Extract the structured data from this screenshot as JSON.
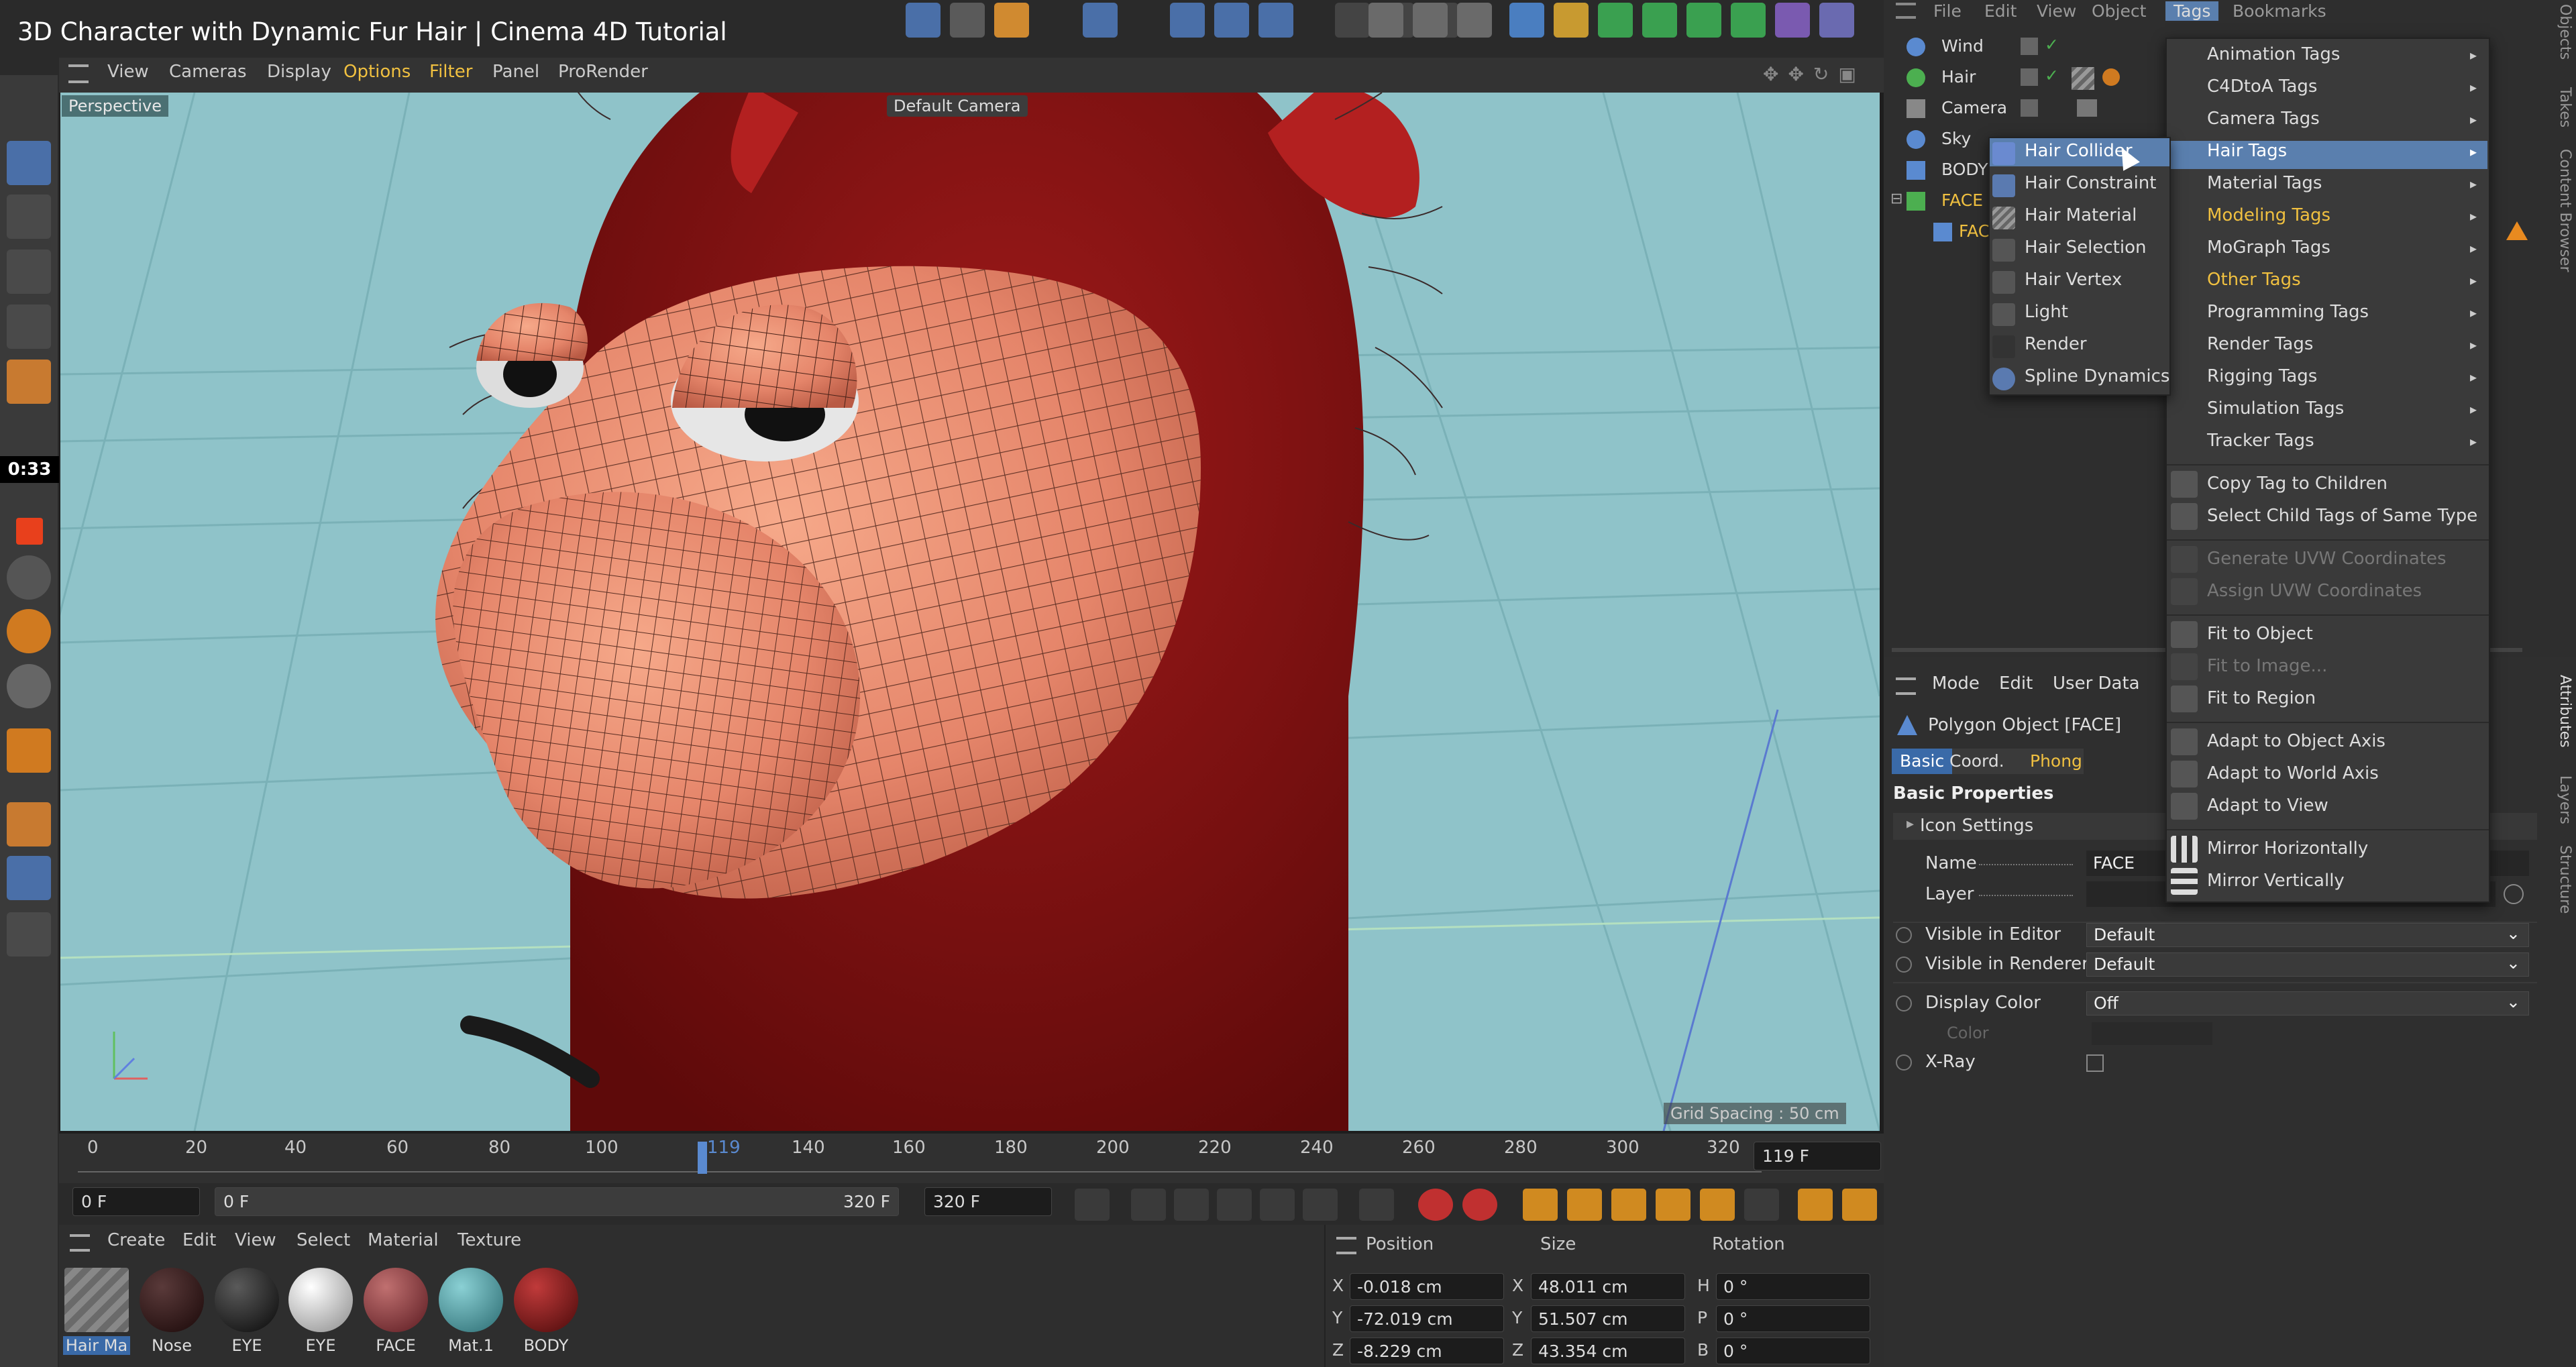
{
  "video": {
    "title": "3D Character with Dynamic Fur Hair | Cinema 4D Tutorial",
    "timestamp": "0:33"
  },
  "viewport": {
    "menu": [
      "View",
      "Cameras",
      "Display",
      "Options",
      "Filter",
      "Panel",
      "ProRender"
    ],
    "view_name": "Perspective",
    "camera": "Default Camera",
    "grid_spacing": "Grid Spacing : 50 cm"
  },
  "timeline": {
    "ticks": [
      "0",
      "20",
      "40",
      "60",
      "80",
      "100",
      "119",
      "140",
      "160",
      "180",
      "200",
      "220",
      "240",
      "260",
      "280",
      "300",
      "320"
    ],
    "current_frame": "119 F",
    "start": "0 F",
    "range_start": "0 F",
    "range_end": "320 F",
    "end": "320 F"
  },
  "material_manager": {
    "menu": [
      "Create",
      "Edit",
      "View",
      "Select",
      "Material",
      "Texture"
    ],
    "materials": [
      {
        "name": "Hair Ma",
        "color": "#7a7a7a"
      },
      {
        "name": "Nose",
        "color": "#2a1414"
      },
      {
        "name": "EYE",
        "color": "#141414"
      },
      {
        "name": "EYE",
        "color": "#cfcfcf"
      },
      {
        "name": "FACE",
        "color": "#8a3a3e"
      },
      {
        "name": "Mat.1",
        "color": "#4a9ea4"
      },
      {
        "name": "BODY",
        "color": "#7a1414"
      }
    ]
  },
  "coordinates": {
    "headers": [
      "Position",
      "Size",
      "Rotation"
    ],
    "rows": [
      {
        "axis": "X",
        "pos": "-0.018 cm",
        "saxis": "X",
        "size": "48.011 cm",
        "raxis": "H",
        "rot": "0 °"
      },
      {
        "axis": "Y",
        "pos": "-72.019 cm",
        "saxis": "Y",
        "size": "51.507 cm",
        "raxis": "P",
        "rot": "0 °"
      },
      {
        "axis": "Z",
        "pos": "-8.229 cm",
        "saxis": "Z",
        "size": "43.354 cm",
        "raxis": "B",
        "rot": "0 °"
      }
    ]
  },
  "object_manager": {
    "menu": [
      "File",
      "Edit",
      "View",
      "Object",
      "Tags",
      "Bookmarks"
    ],
    "objects": [
      "Wind",
      "Hair",
      "Camera",
      "Sky",
      "BODY",
      "FACE",
      "FAC"
    ]
  },
  "attributes": {
    "menu": [
      "Mode",
      "Edit",
      "User Data"
    ],
    "object": "Polygon Object [FACE]",
    "tabs": [
      "Basic",
      "Coord.",
      "Phong"
    ],
    "section": "Basic Properties",
    "icon_settings": "Icon Settings",
    "name_label": "Name",
    "name_value": "FACE",
    "layer_label": "Layer",
    "visible_editor_label": "Visible in Editor",
    "visible_editor": "Default",
    "visible_renderer_label": "Visible in Renderer",
    "visible_renderer": "Default",
    "display_color_label": "Display Color",
    "display_color": "Off",
    "color_label": "Color",
    "xray_label": "X-Ray"
  },
  "tags_menu": {
    "categories": [
      "Animation Tags",
      "C4DtoA Tags",
      "Camera Tags",
      "Hair Tags",
      "Material Tags",
      "Modeling Tags",
      "MoGraph Tags",
      "Other Tags",
      "Programming Tags",
      "Render Tags",
      "Rigging Tags",
      "Simulation Tags",
      "Tracker Tags"
    ],
    "actions": [
      "Copy Tag to Children",
      "Select Child Tags of Same Type"
    ],
    "uvw": [
      "Generate UVW Coordinates",
      "Assign UVW Coordinates"
    ],
    "fit": [
      "Fit to Object",
      "Fit to Image...",
      "Fit to Region"
    ],
    "adapt": [
      "Adapt to Object Axis",
      "Adapt to World Axis",
      "Adapt to View"
    ],
    "mirror": [
      "Mirror Horizontally",
      "Mirror Vertically"
    ]
  },
  "hair_submenu": [
    "Hair Collider",
    "Hair Constraint",
    "Hair Material",
    "Hair Selection",
    "Hair Vertex",
    "Light",
    "Render",
    "Spline Dynamics"
  ],
  "side_tabs": [
    "Objects",
    "Takes",
    "Content Browser",
    "Attributes",
    "Layers",
    "Structure"
  ],
  "colors": {
    "accent": "#4a90d9",
    "highlight": "#5a7fae",
    "yellow_text": "#f0c040",
    "skin": "#e58a6c",
    "hood": "#8b1414"
  }
}
